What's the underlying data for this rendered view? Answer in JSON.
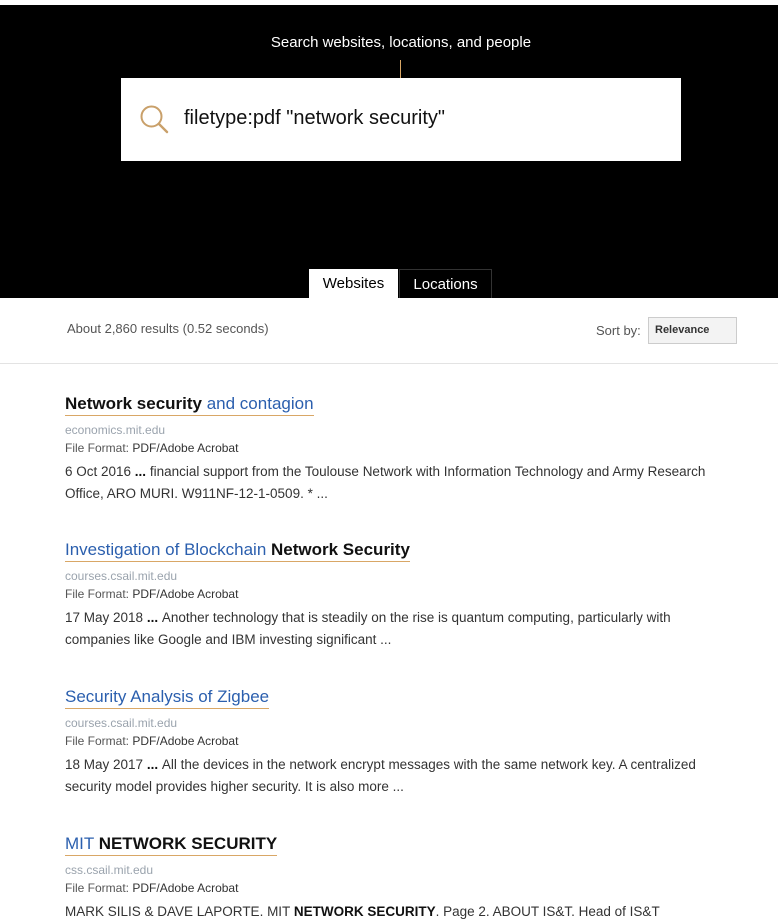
{
  "hero": {
    "label": "Search websites, locations, and people",
    "query": "filetype:pdf \"network security\""
  },
  "tabs": [
    {
      "label": "Websites",
      "active": true
    },
    {
      "label": "Locations",
      "active": false
    }
  ],
  "results_bar": {
    "count": "About 2,860 results (0.52 seconds)",
    "sort_label": "Sort by:",
    "sort_value": "Relevance"
  },
  "results": [
    {
      "title_bold": "Network security",
      "title_rest": " and contagion",
      "url": "economics.mit.edu",
      "format_label": "File Format:",
      "format_value": "PDF/Adobe Acrobat",
      "date": "6 Oct 2016",
      "ellipsis": " ... ",
      "snippet": "financial support from the Toulouse Network with Information Technology and Army Research Office, ARO MURI. W911NF-12-1-0509. * ..."
    },
    {
      "title_pre": "Investigation of Blockchain ",
      "title_bold": "Network Security",
      "url": "courses.csail.mit.edu",
      "format_label": "File Format:",
      "format_value": "PDF/Adobe Acrobat",
      "date": "17 May 2018",
      "ellipsis": " ... ",
      "snippet": "Another technology that is steadily on the rise is quantum computing, particularly with companies like Google and IBM investing significant ..."
    },
    {
      "title": "Security Analysis of Zigbee",
      "url": "courses.csail.mit.edu",
      "format_label": "File Format:",
      "format_value": "PDF/Adobe Acrobat",
      "date": "18 May 2017",
      "ellipsis": " ... ",
      "snippet": "All the devices in the network encrypt messages with the same network key. A centralized security model provides higher security. It is also more ..."
    },
    {
      "title_pre": "MIT ",
      "title_bold": "NETWORK SECURITY",
      "url": "css.csail.mit.edu",
      "format_label": "File Format:",
      "format_value": "PDF/Adobe Acrobat",
      "snippet_pre": "MARK SILIS & DAVE LAPORTE. MIT ",
      "snippet_bold": "NETWORK SECURITY",
      "snippet_post": ". Page 2. ABOUT IS&T. Head of IS&T"
    }
  ]
}
